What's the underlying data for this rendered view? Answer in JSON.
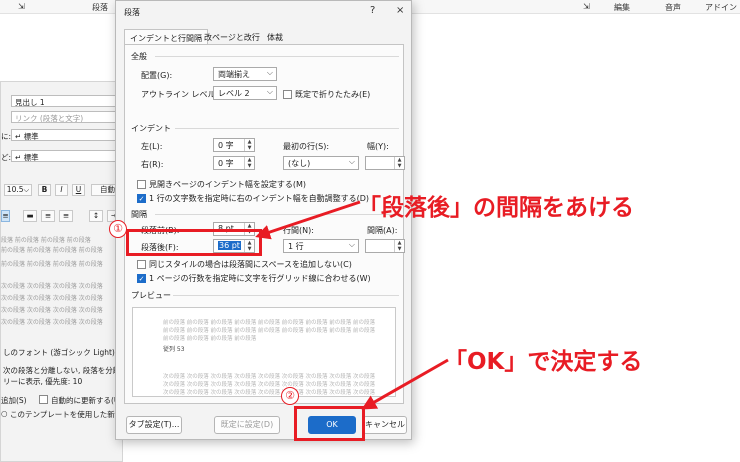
{
  "ribbon": {
    "left_label": "段落",
    "right_items": [
      "編集",
      "音声",
      "アドイン"
    ]
  },
  "bg_dialog": {
    "style_based_name": "見出し 1",
    "link_label": "リンク (段落と文字)",
    "row1_prefix": "に:",
    "row1_value": "↵ 標準",
    "row2_prefix": "ど:",
    "row2_value": "↵ 標準",
    "font_size": "10.5",
    "bold": "B",
    "italic": "I",
    "underline": "U",
    "auto_label": "自動",
    "preview_lines": [
      "段落 前の段落 前の段落 前の段落",
      "前の段落 前の段落 前の段落 前の段落",
      "前の段落 前の段落 前の段落 前の段落",
      "",
      "次の段落 次の段落 次の段落 次の段落",
      "次の段落 次の段落 次の段落 次の段落",
      "次の段落 次の段落 次の段落 次の段落",
      "次の段落 次の段落 次の段落 次の段落"
    ],
    "desc1": "しのフォント (游ゴシック Light), 間隔",
    "desc2": "次の段落と分離しない, 段落を分離しな",
    "desc3": "リーに表示, 優先度: 10",
    "add_label": "追加(S)",
    "auto_update_label": "自動的に更新する(U)",
    "template_label": "このテンプレートを使用した新規文書"
  },
  "dialog": {
    "title": "段落",
    "help": "?",
    "close": "×",
    "tabs": [
      "インデントと行間隔",
      "改ページと改行",
      "体裁"
    ],
    "general": {
      "heading": "全般",
      "alignment_label": "配置(G):",
      "alignment_value": "両端揃え",
      "outline_label": "アウトライン レベル(O):",
      "outline_value": "レベル 2",
      "collapse_label": "既定で折りたたみ(E)"
    },
    "indent": {
      "heading": "インデント",
      "left_label": "左(L):",
      "left_value": "0 字",
      "right_label": "右(R):",
      "right_value": "0 字",
      "first_line_label": "最初の行(S):",
      "first_line_value": "(なし)",
      "width_label": "幅(Y):",
      "width_value": "",
      "mirror_label": "見開きページのインデント幅を設定する(M)",
      "auto_adjust_label": "1 行の文字数を指定時に右のインデント幅を自動調整する(D)"
    },
    "spacing": {
      "heading": "間隔",
      "before_label": "段落前(B):",
      "before_value": "8 pt",
      "after_label": "段落後(F):",
      "after_value": "36 pt",
      "line_label": "行間(N):",
      "line_value": "1 行",
      "at_label": "間隔(A):",
      "at_value": "",
      "same_style_label": "同じスタイルの場合は段落間にスペースを追加しない(C)",
      "grid_label": "1 ページの行数を指定時に文字を行グリッド線に合わせる(W)"
    },
    "preview": {
      "heading": "プレビュー",
      "prev_lines": [
        "前の段落 前の段落 前の段落 前の段落 前の段落 前の段落 前の段落 前の段落 前の段落",
        "前の段落 前の段落 前の段落 前の段落 前の段落 前の段落 前の段落 前の段落 前の段落",
        "前の段落 前の段落 前の段落 前の段落"
      ],
      "sample": "従列 53",
      "next_lines": [
        "次の段落 次の段落 次の段落 次の段落 次の段落 次の段落 次の段落 次の段落 次の段落",
        "次の段落 次の段落 次の段落 次の段落 次の段落 次の段落 次の段落 次の段落 次の段落",
        "次の段落 次の段落 次の段落 次の段落 次の段落 次の段落 次の段落 次の段落 次の段落"
      ]
    },
    "buttons": {
      "tabs": "タブ設定(T)...",
      "default": "既定に設定(D)",
      "ok": "OK",
      "cancel": "キャンセル"
    }
  },
  "annotations": {
    "num1": "①",
    "num2": "②",
    "callout1": "「段落後」の間隔をあける",
    "callout2": "「OK」で決定する",
    "color": "#e81c24"
  }
}
